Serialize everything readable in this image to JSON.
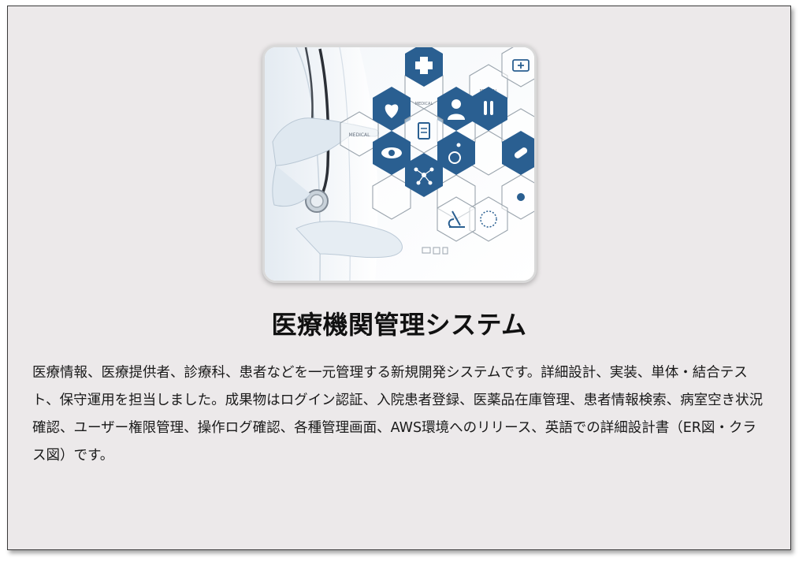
{
  "project": {
    "title": "医療機関管理システム",
    "description": "医療情報、医療提供者、診療科、患者などを一元管理する新規開発システムです。詳細設計、実装、単体・結合テスト、保守運用を担当しました。成果物はログイン認証、入院患者登録、医薬品在庫管理、患者情報検索、病室空き状況確認、ユーザー権限管理、操作ログ確認、各種管理画面、AWS環境へのリリース、英語での詳細設計書（ER図・クラス図）です。",
    "image": {
      "hex_labels": [
        "MEDICAL",
        "MEDICAL",
        "MEDICAL"
      ],
      "icons": [
        "heart-icon",
        "medical-cross-icon",
        "doctor-icon",
        "clipboard-icon",
        "eye-icon",
        "molecule-icon",
        "microscope-icon",
        "wheelchair-icon",
        "test-tubes-icon",
        "pill-icon",
        "medical-kit-icon",
        "stethoscope-icon"
      ],
      "colors": {
        "hex_fill": "#2a5f91",
        "hex_outline": "#9aa4ad",
        "coat": "#f2f5f8",
        "glove": "#dfe8f0"
      }
    }
  }
}
